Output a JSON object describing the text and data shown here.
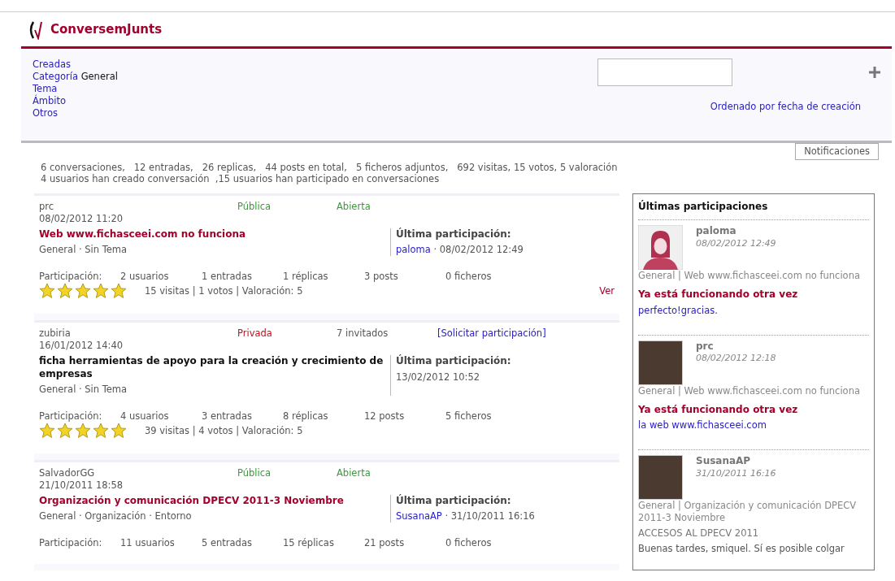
{
  "app": {
    "name": "ConversemJunts"
  },
  "filters": [
    {
      "label": "Creadas"
    },
    {
      "label": "Categoría",
      "value": "General"
    },
    {
      "label": "Tema"
    },
    {
      "label": "Ámbito"
    },
    {
      "label": "Otros"
    }
  ],
  "sort_link": "Ordenado por fecha de creación",
  "notifications_button": "Notificaciones",
  "stats": [
    "6 conversaciones,   12 entradas,   26 replicas,   44 posts en total,   5 ficheros adjuntos,   692 visitas, 15 votos, 5 valoración",
    "4 usuarios han creado conversación  ,15 usuarios han participado en conversaciones"
  ],
  "conversations": [
    {
      "author": "prc",
      "date": "08/02/2012 11:20",
      "kind": "public",
      "visibility": "Pública",
      "status": "Abierta",
      "title": "Web www.fichasceei.com no funciona",
      "tags": "General · Sin Tema",
      "last_label": "Última participación:",
      "last_user": "paloma",
      "last_date": "· 08/02/2012 12:49",
      "participation_label": "Participación:",
      "counts": [
        "2 usuarios",
        "1 entradas",
        "1 réplicas",
        "3 posts",
        "0 ficheros"
      ],
      "stars": 5,
      "rating": "15 visitas | 1 votos | Valoración: 5",
      "view_link": "Ver"
    },
    {
      "author": "zubiria",
      "date": "16/01/2012 14:40",
      "kind": "private",
      "visibility": "Privada",
      "status": "7 invitados",
      "request_link": "[Solicitar participación]",
      "title": "ficha herramientas de apoyo para la creación y crecimiento de empresas",
      "tags": "General · Sin Tema",
      "last_label": "Última participación:",
      "last_date": "13/02/2012 10:52",
      "participation_label": "Participación:",
      "counts": [
        "4 usuarios",
        "3 entradas",
        "8 réplicas",
        "12 posts",
        "5 ficheros"
      ],
      "stars": 5,
      "rating": "39 visitas | 4 votos | Valoración: 5"
    },
    {
      "author": "SalvadorGG",
      "date": "21/10/2011 18:58",
      "kind": "public",
      "visibility": "Pública",
      "status": "Abierta",
      "title": "Organización y comunicación DPECV 2011-3 Noviembre",
      "tags": "General · Organización · Entorno",
      "last_label": "Última participación:",
      "last_user": "SusanaAP",
      "last_date": "· 31/10/2011 16:16",
      "participation_label": "Participación:",
      "counts": [
        "11 usuarios",
        "5 entradas",
        "15 réplicas",
        "21 posts",
        "0 ficheros"
      ]
    }
  ],
  "recent": {
    "title": "Últimas participaciones",
    "posts": [
      {
        "user": "paloma",
        "date": "08/02/2012 12:49",
        "photo": false,
        "context": "General | Web www.fichasceei.com no funciona",
        "kind": "reply",
        "title": "Ya está funcionando otra vez",
        "body": "perfecto!gracias."
      },
      {
        "user": "prc",
        "date": "08/02/2012 12:18",
        "photo": true,
        "context": "General | Web www.fichasceei.com no funciona",
        "kind": "reply",
        "title": "Ya está funcionando otra vez",
        "body": "la web www.fichasceei.com"
      },
      {
        "user": "SusanaAP",
        "date": "31/10/2011 16:16",
        "photo": true,
        "context": "General | Organización y comunicación DPECV 2011-3 Noviembre",
        "kind": "entry",
        "title": "ACCESOS AL DPECV 2011",
        "body": "Buenas tardes, smiquel. Sí es posible colgar"
      }
    ]
  }
}
